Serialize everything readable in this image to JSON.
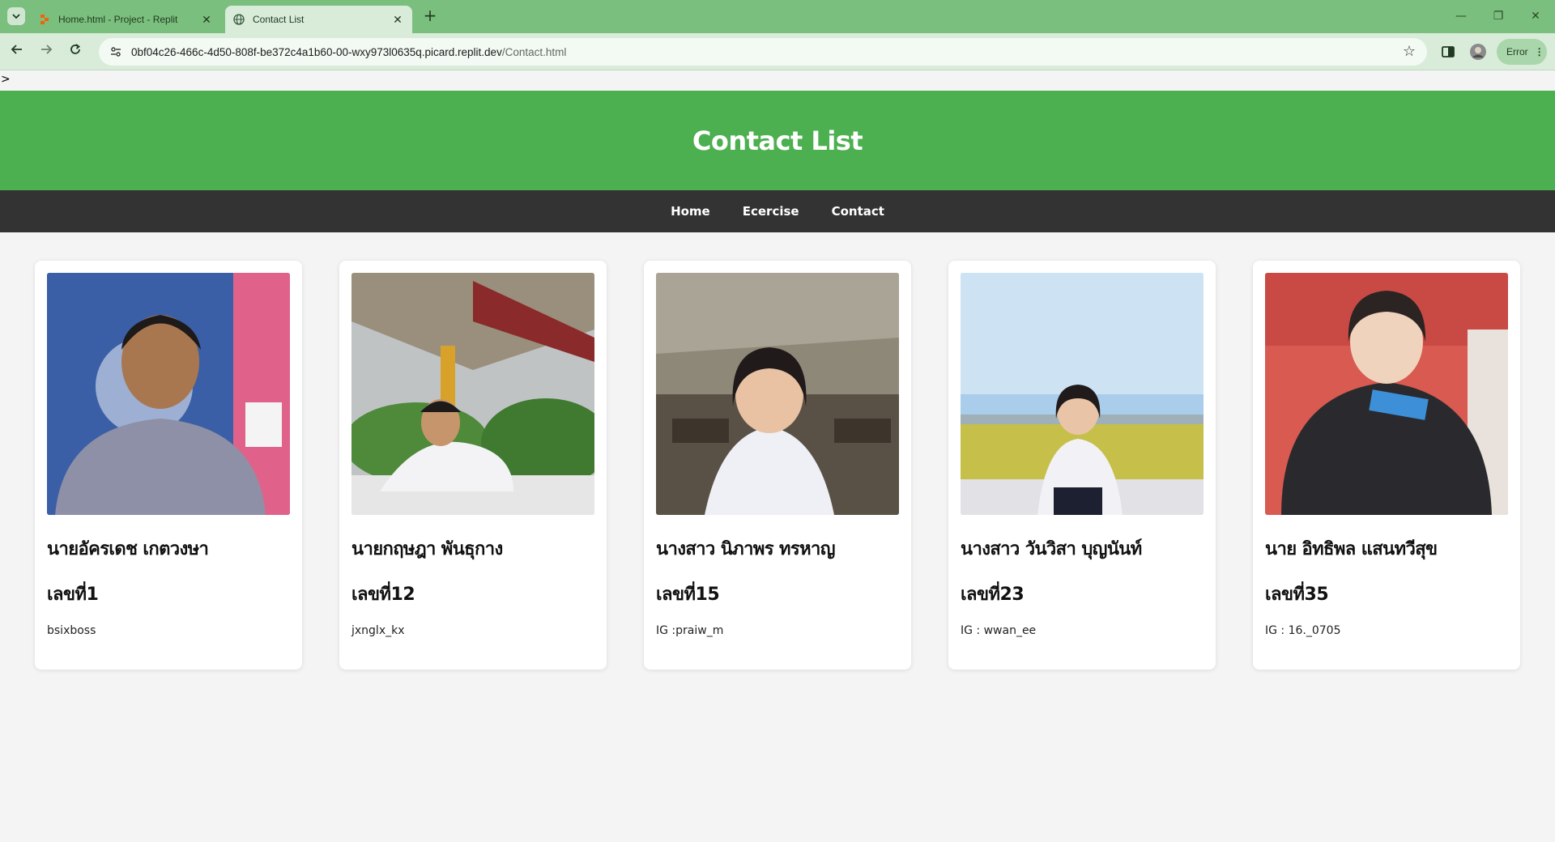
{
  "browser": {
    "tabs": [
      {
        "title": "Home.html - Project - Replit",
        "active": false,
        "icon": "replit-icon"
      },
      {
        "title": "Contact List",
        "active": true,
        "icon": "globe-icon"
      }
    ],
    "url_host": "0bf04c26-466c-4d50-808f-be372c4a1b60-00-wxy973l0635q.picard.replit.dev",
    "url_path": "/Contact.html",
    "profile_status": "Error"
  },
  "page": {
    "stray_text": ">",
    "title": "Contact List",
    "nav": [
      "Home",
      "Ecercise",
      "Contact"
    ],
    "contacts": [
      {
        "name": "นายอัครเดช เกตวงษา",
        "number": "เลขที่1",
        "ig": "bsixboss"
      },
      {
        "name": "นายกฤษฎา พันธุกาง",
        "number": "เลขที่12",
        "ig": "jxnglx_kx"
      },
      {
        "name": "นางสาว นิภาพร ทรหาญ",
        "number": "เลขที่15",
        "ig": "IG :praiw_m"
      },
      {
        "name": "นางสาว วันวิสา บุญนันท์",
        "number": "เลขที่23",
        "ig": "IG : wwan_ee"
      },
      {
        "name": "นาย อิทธิพล แสนทวีสุข",
        "number": "เลขที่35",
        "ig": "IG : 16._0705"
      }
    ]
  },
  "colors": {
    "header_green": "#4caf50",
    "nav_dark": "#333333",
    "tab_strip": "#7bbf7e"
  }
}
